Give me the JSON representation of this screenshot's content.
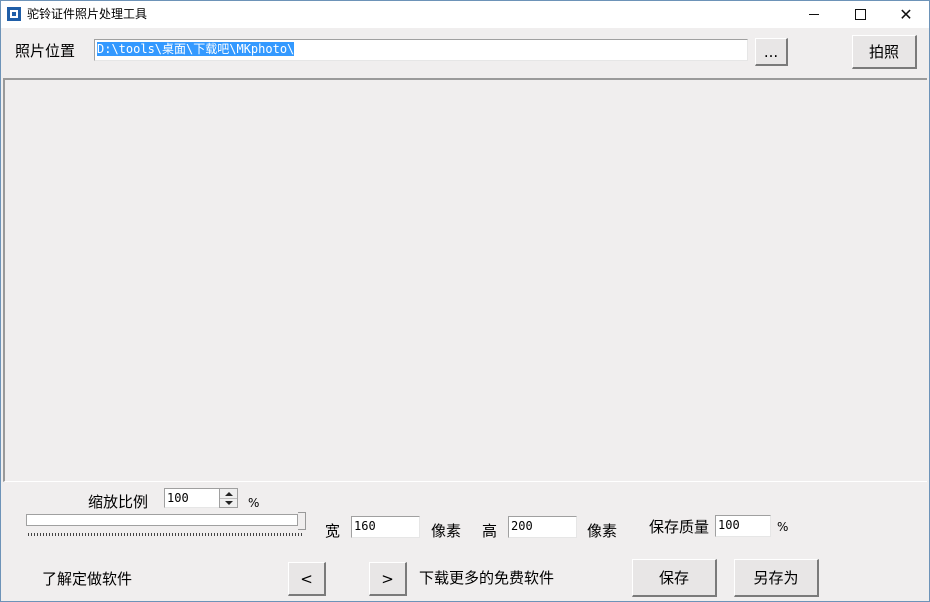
{
  "window": {
    "title": "驼铃证件照片处理工具",
    "controls": {
      "minimize": "",
      "maximize": "",
      "close": "✕"
    }
  },
  "toolbar": {
    "path_label": "照片位置",
    "path_value": "D:\\tools\\桌面\\下载吧\\MKphoto\\",
    "browse_label": "...",
    "capture_label": "拍照"
  },
  "scale": {
    "label": "缩放比例",
    "value": "100",
    "unit": "%",
    "slider_fraction": 1.0
  },
  "size": {
    "width_label": "宽",
    "width_value": "160",
    "width_unit": "像素",
    "height_label": "高",
    "height_value": "200",
    "height_unit": "像素"
  },
  "quality": {
    "label": "保存质量",
    "value": "100",
    "unit": "%"
  },
  "footer": {
    "custom_link": "了解定做软件",
    "prev_label": "<",
    "next_label": ">",
    "more_link": "下载更多的免费软件",
    "save_label": "保存",
    "save_as_label": "另存为"
  },
  "icons": {
    "app": "app-icon",
    "minimize": "minimize-icon",
    "maximize": "maximize-icon",
    "close": "close-icon"
  },
  "colors": {
    "window_border": "#6d93b8",
    "selection": "#3399ff",
    "background": "#f0eeee"
  }
}
